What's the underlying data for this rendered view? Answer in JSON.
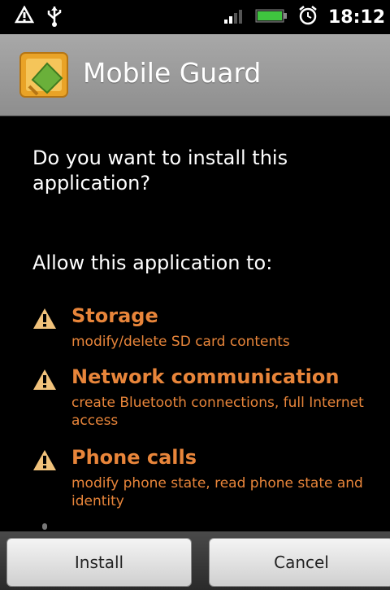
{
  "status_bar": {
    "time": "18:12",
    "icons": [
      "alert-icon",
      "usb-icon",
      "signal-icon",
      "battery-icon",
      "alarm-icon"
    ]
  },
  "header": {
    "icon": "app-icon",
    "title": "Mobile Guard"
  },
  "prompt": {
    "question": "Do you want to install this application?",
    "allow_heading": "Allow this application to:"
  },
  "permissions": [
    {
      "title": "Storage",
      "description": "modify/delete SD card contents",
      "icon": "warning-icon"
    },
    {
      "title": "Network communication",
      "description": "create Bluetooth connections, full Internet access",
      "icon": "warning-icon"
    },
    {
      "title": "Phone calls",
      "description": "modify phone state, read phone state and identity",
      "icon": "warning-icon"
    }
  ],
  "buttons": {
    "install_label": "Install",
    "cancel_label": "Cancel"
  },
  "colors": {
    "permission_text": "#e8853a",
    "warning_icon": "#f1c27b",
    "title_bar": "#9a9a9a",
    "battery": "#3fc43f"
  }
}
